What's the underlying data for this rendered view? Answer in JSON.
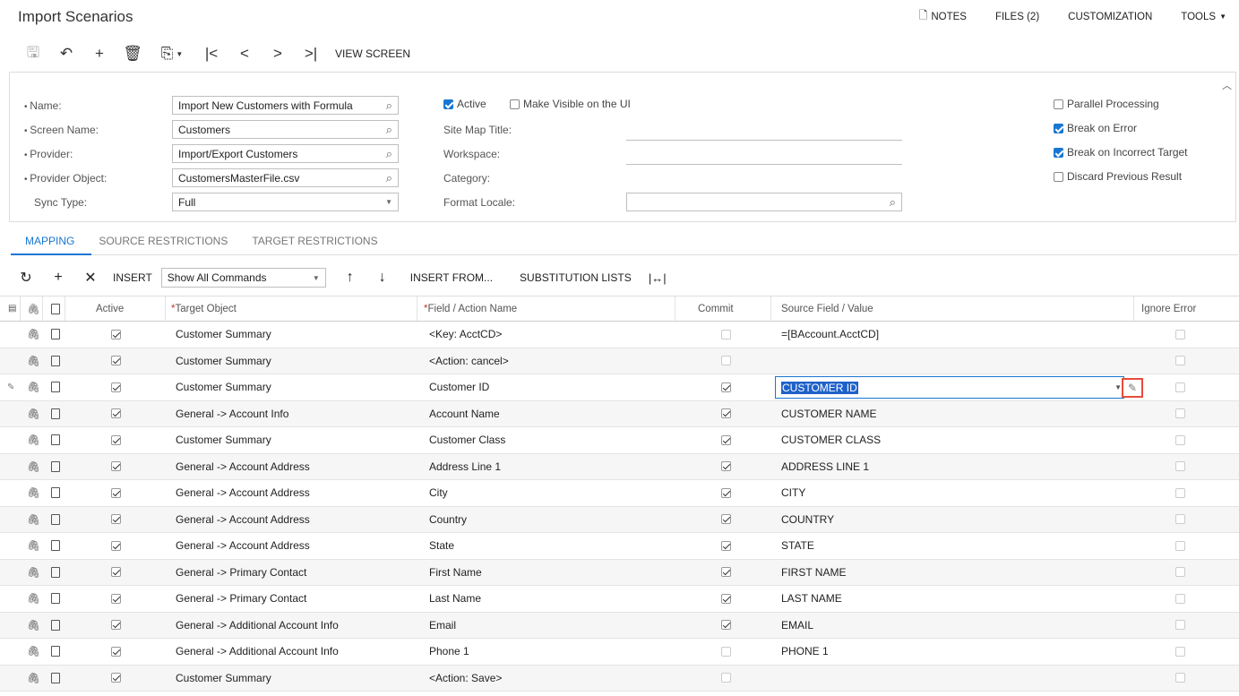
{
  "header": {
    "title": "Import Scenarios",
    "menu": {
      "notes": "NOTES",
      "files": "FILES (2)",
      "customization": "CUSTOMIZATION",
      "tools": "TOOLS"
    }
  },
  "toolbar": {
    "view_screen": "VIEW SCREEN"
  },
  "form": {
    "name_label": "Name:",
    "name_value": "Import New Customers with Formula",
    "screen_label": "Screen Name:",
    "screen_value": "Customers",
    "provider_label": "Provider:",
    "provider_value": "Import/Export Customers",
    "provider_object_label": "Provider Object:",
    "provider_object_value": "CustomersMasterFile.csv",
    "sync_label": "Sync Type:",
    "sync_value": "Full",
    "active_label": "Active",
    "visible_label": "Make Visible on the UI",
    "sitemap_label": "Site Map Title:",
    "workspace_label": "Workspace:",
    "category_label": "Category:",
    "locale_label": "Format Locale:",
    "parallel_label": "Parallel Processing",
    "break_error_label": "Break on Error",
    "break_target_label": "Break on Incorrect Target",
    "discard_label": "Discard Previous Result"
  },
  "tabs": {
    "mapping": "MAPPING",
    "source": "SOURCE RESTRICTIONS",
    "target": "TARGET RESTRICTIONS"
  },
  "grid_toolbar": {
    "insert": "INSERT",
    "commands": "Show All Commands",
    "insert_from": "INSERT FROM...",
    "substitution": "SUBSTITUTION LISTS"
  },
  "grid": {
    "headers": {
      "active": "Active",
      "target": "Target Object",
      "field": "Field / Action Name",
      "commit": "Commit",
      "source": "Source Field / Value",
      "ignore": "Ignore Error"
    },
    "rows": [
      {
        "target": "Customer Summary",
        "field": "<Key: AcctCD>",
        "commit": false,
        "source": "=[BAccount.AcctCD]"
      },
      {
        "target": "Customer Summary",
        "field": "<Action: cancel>",
        "commit": false,
        "source": ""
      },
      {
        "target": "Customer Summary",
        "field": "Customer ID",
        "commit": true,
        "source": "CUSTOMER ID"
      },
      {
        "target": "General -> Account Info",
        "field": "Account Name",
        "commit": true,
        "source": "CUSTOMER NAME"
      },
      {
        "target": "Customer Summary",
        "field": "Customer Class",
        "commit": true,
        "source": "CUSTOMER CLASS"
      },
      {
        "target": "General -> Account Address",
        "field": "Address Line 1",
        "commit": true,
        "source": "ADDRESS LINE 1"
      },
      {
        "target": "General -> Account Address",
        "field": "City",
        "commit": true,
        "source": "CITY"
      },
      {
        "target": "General -> Account Address",
        "field": "Country",
        "commit": true,
        "source": "COUNTRY"
      },
      {
        "target": "General -> Account Address",
        "field": "State",
        "commit": true,
        "source": "STATE"
      },
      {
        "target": "General -> Primary Contact",
        "field": "First Name",
        "commit": true,
        "source": "FIRST NAME"
      },
      {
        "target": "General -> Primary Contact",
        "field": "Last Name",
        "commit": true,
        "source": "LAST NAME"
      },
      {
        "target": "General -> Additional Account Info",
        "field": "Email",
        "commit": true,
        "source": "EMAIL"
      },
      {
        "target": "General -> Additional Account Info",
        "field": "Phone 1",
        "commit": false,
        "source": "PHONE 1"
      },
      {
        "target": "Customer Summary",
        "field": "<Action: Save>",
        "commit": false,
        "source": ""
      }
    ]
  }
}
